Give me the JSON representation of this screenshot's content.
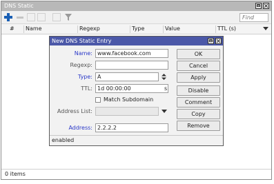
{
  "window": {
    "title": "DNS Static"
  },
  "toolbar": {
    "search_placeholder": "Find",
    "icons": [
      "add-icon",
      "remove-icon",
      "enable-icon",
      "disable-icon",
      "comment-icon",
      "filter-icon"
    ]
  },
  "table": {
    "columns": [
      "#",
      "Name",
      "Regexp",
      "Type",
      "Value",
      "TTL (s)"
    ]
  },
  "status": {
    "items": "0 items"
  },
  "dialog": {
    "title": "New DNS Static Entry",
    "fields": {
      "name": {
        "label": "Name:",
        "value": "www.facebook.com"
      },
      "regexp": {
        "label": "Regexp:",
        "value": ""
      },
      "type": {
        "label": "Type:",
        "value": "A"
      },
      "ttl": {
        "label": "TTL:",
        "value": "1d 00:00:00",
        "unit": "s"
      },
      "match_subdomain": {
        "label": "Match Subdomain",
        "checked": false
      },
      "address_list": {
        "label": "Address List:",
        "value": ""
      },
      "address": {
        "label": "Address:",
        "value": "2.2.2.2"
      }
    },
    "buttons": {
      "ok": "OK",
      "cancel": "Cancel",
      "apply": "Apply",
      "disable": "Disable",
      "comment": "Comment",
      "copy": "Copy",
      "remove": "Remove"
    },
    "status": "enabled"
  },
  "colors": {
    "dialog_title_bg": "#4b58a8",
    "label_accent": "#2a38c8",
    "add_icon": "#1a5fb4"
  }
}
